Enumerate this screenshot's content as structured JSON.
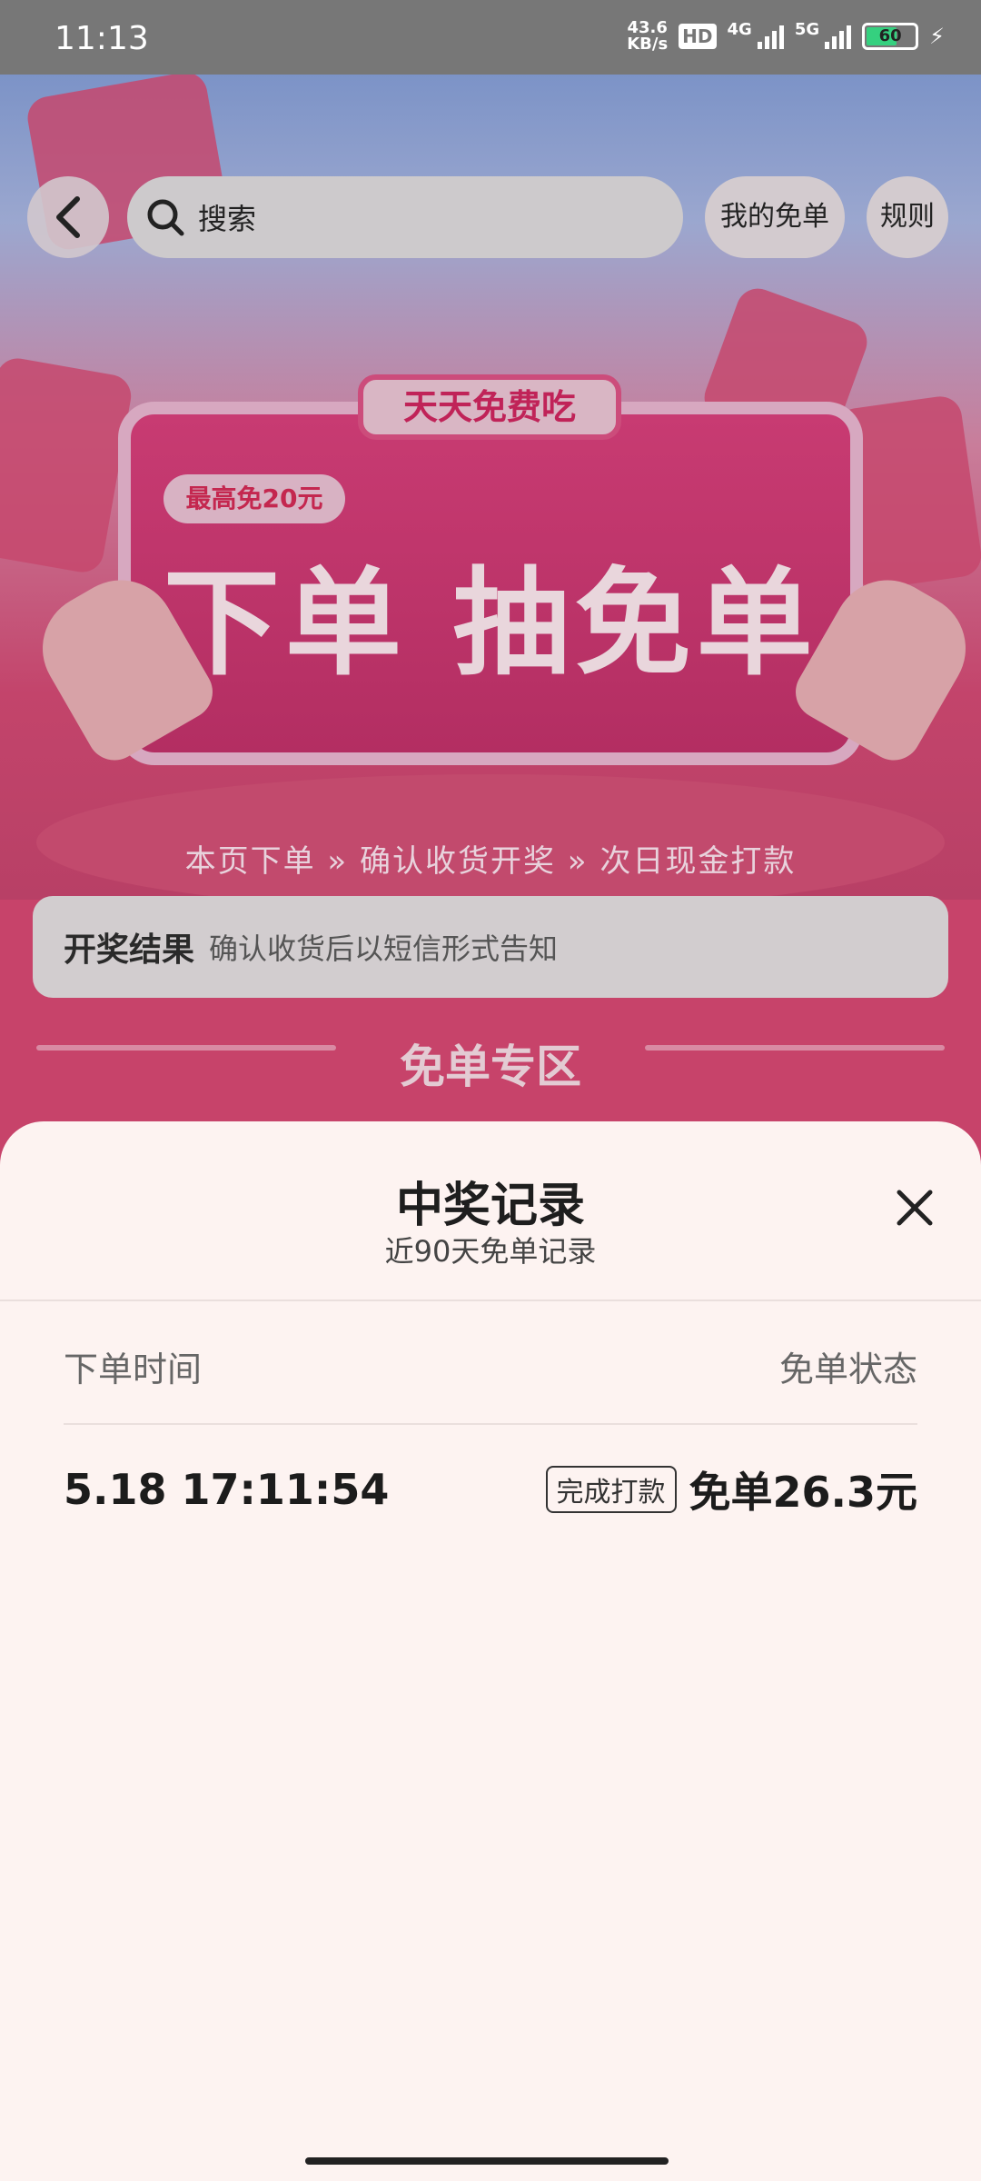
{
  "status_bar": {
    "time": "11:13",
    "net_speed_value": "43.6",
    "net_speed_unit": "KB/s",
    "hd_badge": "HD",
    "network_4g": "4G",
    "network_5g": "5G",
    "battery": "60"
  },
  "nav": {
    "search_placeholder": "搜索",
    "my_free_orders": "我的免单",
    "rules": "规则"
  },
  "banner": {
    "tag": "天天免费吃",
    "sub_tag": "最高免20元",
    "title": "下单 抽免单",
    "steps": "本页下单  »  确认收货开奖  »  次日现金打款"
  },
  "result_bar": {
    "title": "开奖结果",
    "description": "确认收货后以短信形式告知"
  },
  "section": {
    "title": "免单专区"
  },
  "sheet": {
    "title": "中奖记录",
    "subtitle": "近90天免单记录",
    "columns": [
      "下单时间",
      "免单状态"
    ],
    "records": [
      {
        "time": "5.18 17:11:54",
        "status": "完成打款",
        "amount": "免单26.3元"
      }
    ]
  }
}
